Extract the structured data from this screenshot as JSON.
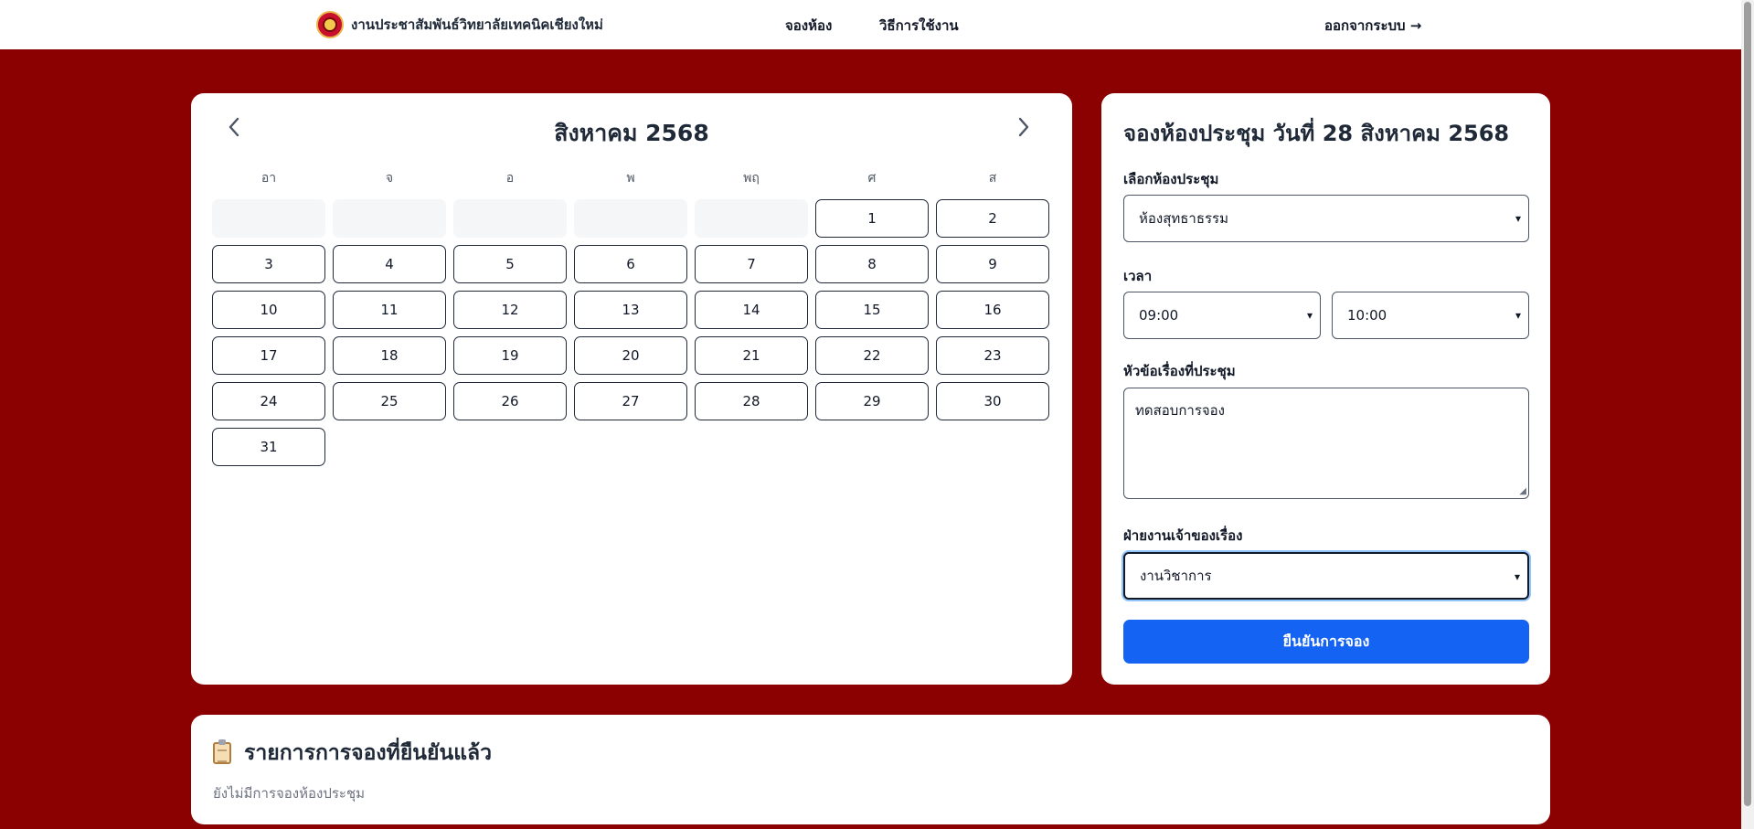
{
  "header": {
    "brand": "งานประชาสัมพันธ์วิทยาลัยเทคนิคเชียงใหม่",
    "nav": [
      "จองห้อง",
      "วิธีการใช้งาน"
    ],
    "logout": "ออกจากระบบ →"
  },
  "calendar": {
    "month_title": "สิงหาคม 2568",
    "weekdays": [
      "อา",
      "จ",
      "อ",
      "พ",
      "พฤ",
      "ศ",
      "ส"
    ],
    "days": [
      "1",
      "2",
      "3",
      "4",
      "5",
      "6",
      "7",
      "8",
      "9",
      "10",
      "11",
      "12",
      "13",
      "14",
      "15",
      "16",
      "17",
      "18",
      "19",
      "20",
      "21",
      "22",
      "23",
      "24",
      "25",
      "26",
      "27",
      "28",
      "29",
      "30",
      "31"
    ]
  },
  "form": {
    "title": "จองห้องประชุม วันที่ 28 สิงหาคม 2568",
    "room_label": "เลือกห้องประชุม",
    "room_value": "ห้องสุทธาธรรม",
    "time_label": "เวลา",
    "start_time": "09:00",
    "end_time": "10:00",
    "topic_label": "หัวข้อเรื่องที่ประชุม",
    "topic_value": "ทดสอบการจอง",
    "dept_label": "ฝ่ายงานเจ้าของเรื่อง",
    "dept_value": "งานวิชาการ",
    "submit_label": "ยืนยันการจอง"
  },
  "bookings": {
    "title": "รายการการจองที่ยืนยันแล้ว",
    "empty": "ยังไม่มีการจองห้องประชุม"
  },
  "colors": {
    "background": "#8b0000",
    "primary": "#1463f3"
  }
}
